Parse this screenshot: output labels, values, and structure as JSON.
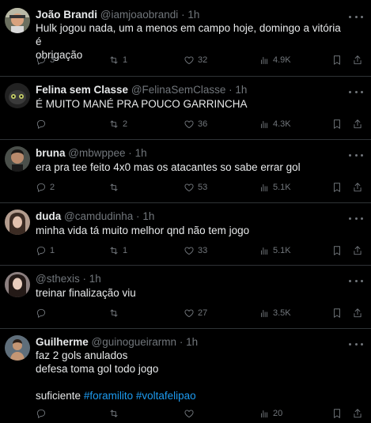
{
  "tweets": [
    {
      "name": "João Brandi",
      "handle": "@iamjoaobrandi",
      "time": "1h",
      "lines": [
        "Hulk jogou nada, um a menos em campo hoje, domingo a vitória é",
        "obrigação"
      ],
      "replies": "3",
      "retweets": "1",
      "likes": "32",
      "views": "4.9K"
    },
    {
      "name": "Felina sem Classe",
      "handle": "@FelinaSemClasse",
      "time": "1h",
      "lines": [
        "É MUITO MANÉ PRA POUCO GARRINCHA"
      ],
      "replies": "",
      "retweets": "2",
      "likes": "36",
      "views": "4.3K"
    },
    {
      "name": "bruna",
      "handle": "@mbwppee",
      "time": "1h",
      "lines": [
        "era pra tee feito 4x0 mas os atacantes so sabe errar gol"
      ],
      "replies": "2",
      "retweets": "",
      "likes": "53",
      "views": "5.1K"
    },
    {
      "name": "duda",
      "handle": "@camdudinha",
      "time": "1h",
      "lines": [
        "minha vida tá muito melhor qnd não tem jogo"
      ],
      "replies": "1",
      "retweets": "1",
      "likes": "33",
      "views": "5.1K"
    },
    {
      "name": "",
      "handle": "@sthexis",
      "time": "1h",
      "lines": [
        "treinar finalização viu"
      ],
      "replies": "",
      "retweets": "",
      "likes": "27",
      "views": "3.5K"
    },
    {
      "name": "Guilherme",
      "handle": "@guinogueirarmn",
      "time": "1h",
      "lines": [
        "faz 2 gols anulados",
        "defesa toma gol todo jogo",
        "",
        "suficiente"
      ],
      "hashtags": [
        "#foramilito",
        "#voltafelipao"
      ],
      "replies": "",
      "retweets": "",
      "likes": "",
      "views": "20"
    }
  ],
  "separator": "·",
  "colors": {
    "background": "#000000",
    "text": "#e7e9ea",
    "muted": "#71767b",
    "link": "#1d9bf0",
    "divider": "#2f3336"
  },
  "icons": [
    "reply-icon",
    "retweet-icon",
    "like-icon",
    "views-icon",
    "bookmark-icon",
    "share-icon",
    "more-icon"
  ]
}
